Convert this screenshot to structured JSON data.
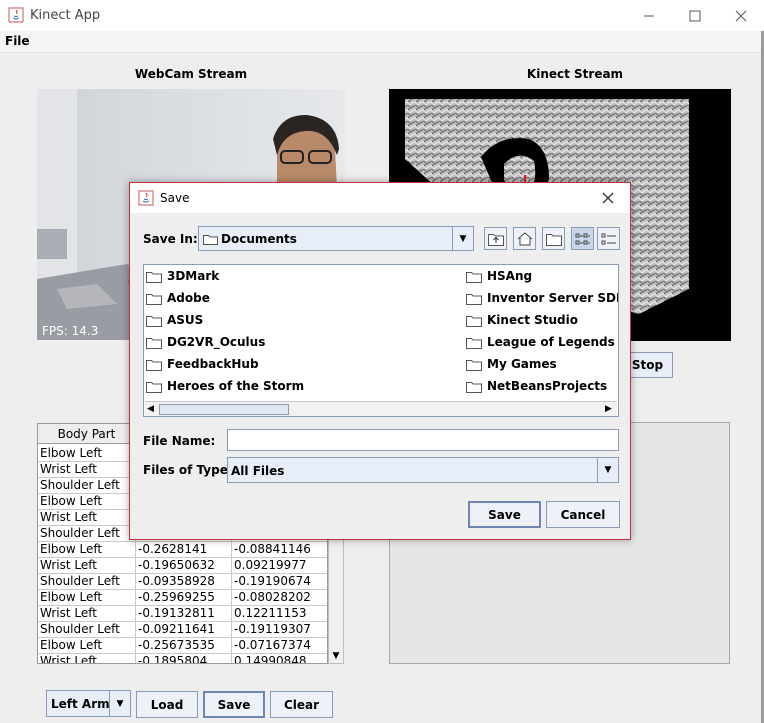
{
  "window": {
    "title": "Kinect App",
    "menu_file": "File"
  },
  "webcam": {
    "heading": "WebCam Stream",
    "fps": "FPS: 14.3"
  },
  "kinect": {
    "heading": "Kinect Stream",
    "stop_label": "Stop"
  },
  "table": {
    "columns": [
      "Body Part",
      "",
      ""
    ],
    "rows": [
      [
        "Elbow Left",
        "",
        ""
      ],
      [
        "Wrist Left",
        "",
        ""
      ],
      [
        "Shoulder Left",
        "",
        ""
      ],
      [
        "Elbow Left",
        "",
        ""
      ],
      [
        "Wrist Left",
        "",
        ""
      ],
      [
        "Shoulder Left",
        "",
        ""
      ],
      [
        "Elbow Left",
        "-0.2628141",
        "-0.08841146"
      ],
      [
        "Wrist Left",
        "-0.19650632",
        "0.09219977"
      ],
      [
        "Shoulder Left",
        "-0.09358928",
        "-0.19190674"
      ],
      [
        "Elbow Left",
        "-0.25969255",
        "-0.08028202"
      ],
      [
        "Wrist Left",
        "-0.19132811",
        "0.12211153"
      ],
      [
        "Shoulder Left",
        "-0.09211641",
        "-0.19119307"
      ],
      [
        "Elbow Left",
        "-0.25673535",
        "-0.07167374"
      ],
      [
        "Wrist Left",
        "-0.1895804",
        "0.14990848"
      ]
    ]
  },
  "bottom": {
    "selector_value": "Left Arm",
    "load_label": "Load",
    "save_label": "Save",
    "clear_label": "Clear"
  },
  "dialog": {
    "title": "Save",
    "save_in_label": "Save In:",
    "save_in_value": "Documents",
    "toolbar_icons": [
      "up-folder-icon",
      "home-icon",
      "new-folder-icon",
      "list-view-icon",
      "details-view-icon"
    ],
    "files_left": [
      "3DMark",
      "Adobe",
      "ASUS",
      "DG2VR_Oculus",
      "FeedbackHub",
      "Heroes of the Storm"
    ],
    "files_right": [
      "HSAng",
      "Inventor Server SDK AC",
      "Kinect Studio",
      "League of Legends",
      "My Games",
      "NetBeansProjects"
    ],
    "file_name_label": "File Name:",
    "file_name_value": "",
    "files_of_type_label": "Files of Type:",
    "files_of_type_value": "All Files",
    "save_button": "Save",
    "cancel_button": "Cancel"
  },
  "colors": {
    "accent_border": "#8a9bb5",
    "dialog_border": "#c3333d",
    "button_face": "#eef2f8"
  }
}
